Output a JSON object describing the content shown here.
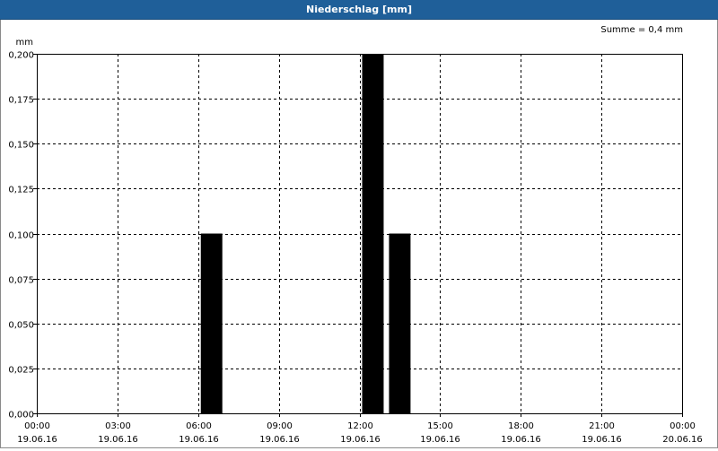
{
  "window": {
    "title": "Niederschlag [mm]"
  },
  "summary": {
    "text": "Summe = 0,4 mm"
  },
  "colors": {
    "titlebar": "#1f5f99",
    "bar": "#000000",
    "grid": "#000000"
  },
  "chart_data": {
    "type": "bar",
    "title": "Niederschlag [mm]",
    "ylabel": "mm",
    "xlabel": "",
    "ylim": [
      0,
      0.2
    ],
    "yticks": [
      {
        "value": 0,
        "label": "0,000"
      },
      {
        "value": 0.025,
        "label": "0,025"
      },
      {
        "value": 0.05,
        "label": "0,050"
      },
      {
        "value": 0.075,
        "label": "0,075"
      },
      {
        "value": 0.1,
        "label": "0,100"
      },
      {
        "value": 0.125,
        "label": "0,125"
      },
      {
        "value": 0.15,
        "label": "0,150"
      },
      {
        "value": 0.175,
        "label": "0,175"
      },
      {
        "value": 0.2,
        "label": "0,200"
      }
    ],
    "xlim": [
      "19.06.16 00:00",
      "20.06.16 00:00"
    ],
    "xticks": [
      {
        "time": "00:00",
        "date": "19.06.16"
      },
      {
        "time": "03:00",
        "date": "19.06.16"
      },
      {
        "time": "06:00",
        "date": "19.06.16"
      },
      {
        "time": "09:00",
        "date": "19.06.16"
      },
      {
        "time": "12:00",
        "date": "19.06.16"
      },
      {
        "time": "15:00",
        "date": "19.06.16"
      },
      {
        "time": "18:00",
        "date": "19.06.16"
      },
      {
        "time": "21:00",
        "date": "19.06.16"
      },
      {
        "time": "00:00",
        "date": "20.06.16"
      }
    ],
    "bars": [
      {
        "start": "19.06.16 06:00",
        "end": "19.06.16 07:00",
        "value": 0.1
      },
      {
        "start": "19.06.16 12:00",
        "end": "19.06.16 13:00",
        "value": 0.2
      },
      {
        "start": "19.06.16 13:00",
        "end": "19.06.16 14:00",
        "value": 0.1
      }
    ],
    "grid": true
  }
}
